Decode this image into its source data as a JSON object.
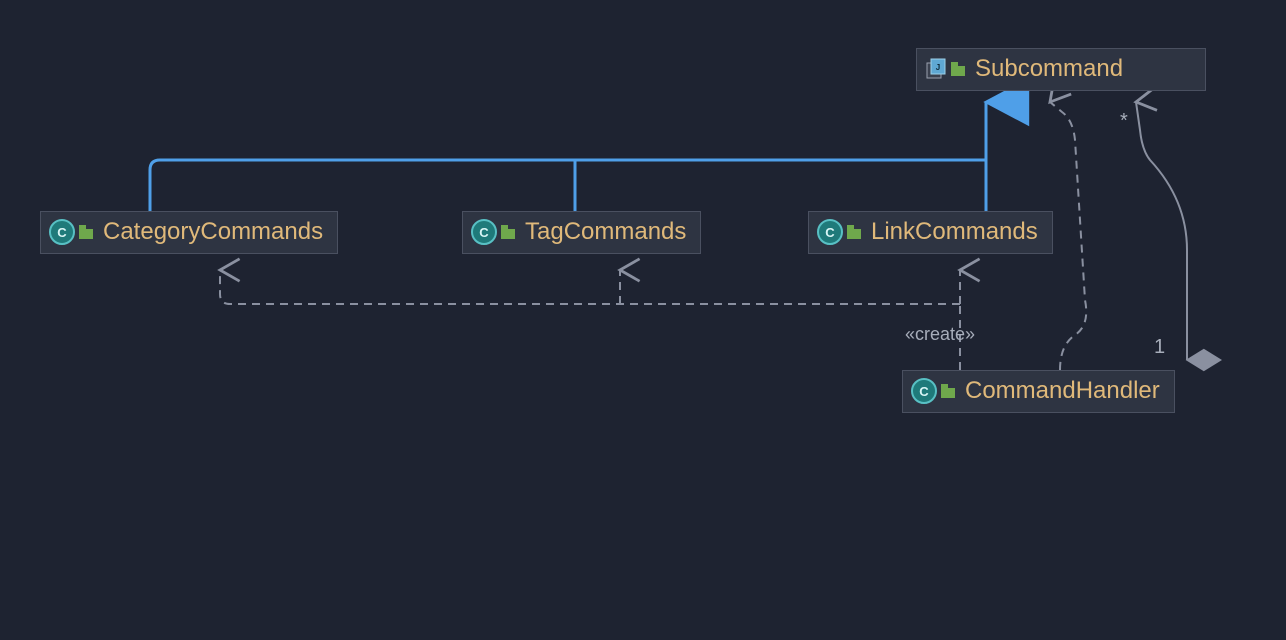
{
  "nodes": {
    "subcommand": {
      "label": "Subcommand",
      "type": "interface"
    },
    "category_commands": {
      "label": "CategoryCommands",
      "type": "class"
    },
    "tag_commands": {
      "label": "TagCommands",
      "type": "class"
    },
    "link_commands": {
      "label": "LinkCommands",
      "type": "class"
    },
    "command_handler": {
      "label": "CommandHandler",
      "type": "class"
    }
  },
  "labels": {
    "create_stereotype": "«create»",
    "multiplicity_star": "*",
    "multiplicity_one": "1"
  },
  "relationships": [
    {
      "from": "CategoryCommands",
      "to": "Subcommand",
      "kind": "realization"
    },
    {
      "from": "TagCommands",
      "to": "Subcommand",
      "kind": "realization"
    },
    {
      "from": "LinkCommands",
      "to": "Subcommand",
      "kind": "realization"
    },
    {
      "from": "CommandHandler",
      "to": "CategoryCommands",
      "kind": "dependency",
      "stereotype": "create"
    },
    {
      "from": "CommandHandler",
      "to": "TagCommands",
      "kind": "dependency",
      "stereotype": "create"
    },
    {
      "from": "CommandHandler",
      "to": "LinkCommands",
      "kind": "dependency",
      "stereotype": "create"
    },
    {
      "from": "CommandHandler",
      "to": "Subcommand",
      "kind": "dependency"
    },
    {
      "from": "CommandHandler",
      "to": "Subcommand",
      "kind": "aggregation",
      "from_mult": "1",
      "to_mult": "*"
    }
  ],
  "colors": {
    "background": "#1e2331",
    "node_bg": "#2e3442",
    "node_border": "#4a5060",
    "text": "#e0b97a",
    "realization_line": "#4f9fe8",
    "dashed_line": "#8a90a0",
    "solid_line": "#8a90a0"
  }
}
